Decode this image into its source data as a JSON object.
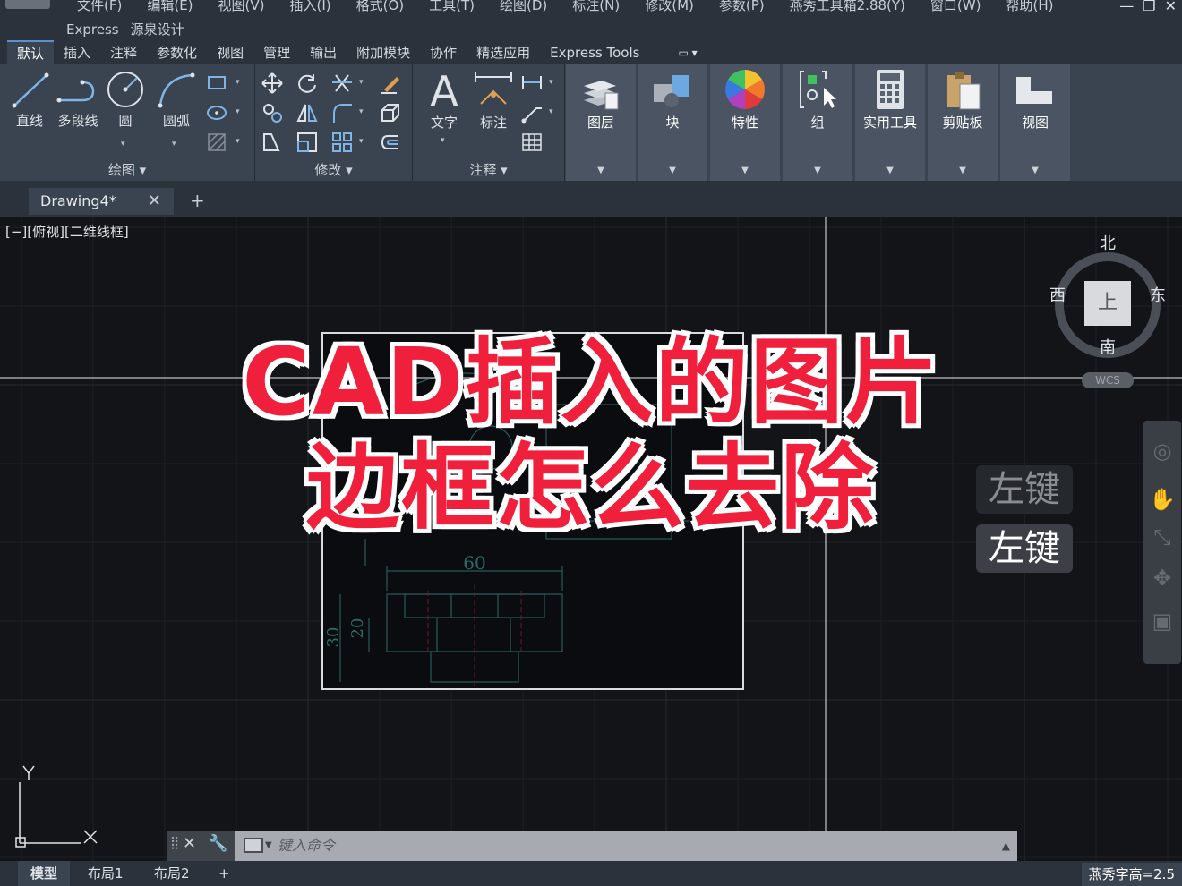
{
  "menubar": {
    "items": [
      "文件(F)",
      "编辑(E)",
      "视图(V)",
      "插入(I)",
      "格式(O)",
      "工具(T)",
      "绘图(D)",
      "标注(N)",
      "修改(M)",
      "参数(P)",
      "燕秀工具箱2.88(Y)",
      "窗口(W)",
      "帮助(H)"
    ],
    "row2": [
      "Express",
      "源泉设计"
    ]
  },
  "ribbon_tabs": [
    "默认",
    "插入",
    "注释",
    "参数化",
    "视图",
    "管理",
    "输出",
    "附加模块",
    "协作",
    "精选应用",
    "Express Tools"
  ],
  "ribbon": {
    "draw_panel": {
      "title": "绘图",
      "tools": [
        "直线",
        "多段线",
        "圆",
        "圆弧"
      ]
    },
    "modify_panel": {
      "title": "修改"
    },
    "annotation_panel": {
      "title": "注释",
      "tools": [
        "文字",
        "标注"
      ]
    },
    "big_panels": [
      "图层",
      "块",
      "特性",
      "组",
      "实用工具",
      "剪贴板",
      "视图"
    ]
  },
  "document": {
    "tab_title": "Drawing4*",
    "close": "✕",
    "new_tab": "+"
  },
  "viewport": {
    "label": "[−][俯视][二维线框]",
    "viewcube": {
      "north": "北",
      "south": "南",
      "east": "东",
      "west": "西",
      "top_face": "上",
      "wcs": "WCS"
    }
  },
  "drawing": {
    "dim_top": "60",
    "dim_left_outer": "30",
    "dim_left_inner": "20"
  },
  "ucs": {
    "x": "X",
    "y": "Y"
  },
  "key_hints": {
    "faded": "左键",
    "active": "左键"
  },
  "overlay": {
    "line1": "CAD插入的图片",
    "line2": "边框怎么去除"
  },
  "command": {
    "placeholder": "键入命令"
  },
  "statusbar": {
    "tabs": [
      "模型",
      "布局1",
      "布局2"
    ],
    "add": "+",
    "right_text": "燕秀字高=2.5"
  },
  "colors": {
    "accent_red": "#f01f3c",
    "ribbon_bg": "#3a4350",
    "canvas_bg": "#121418"
  }
}
